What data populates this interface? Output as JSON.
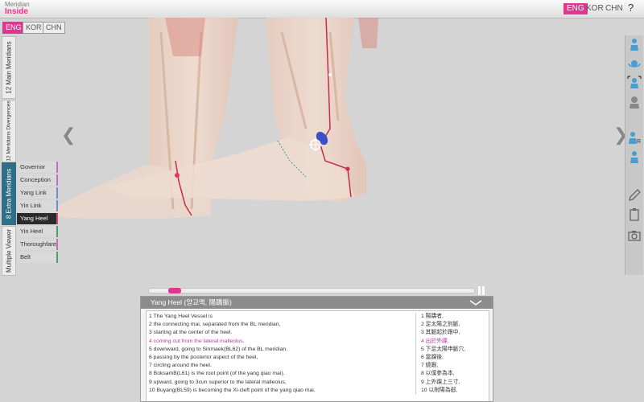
{
  "app": {
    "logo_top": "Meridian",
    "logo_bottom": "Inside",
    "languages": [
      "ENG",
      "KOR",
      "CHN"
    ],
    "active_language": "ENG",
    "help_label": "?"
  },
  "sub_languages": [
    "ENG",
    "KOR",
    "CHN"
  ],
  "left_tabs": [
    "12 Main Meridians",
    "12 Meridians Divergences",
    "8 Extra Meridians",
    "Multiple Viewer"
  ],
  "active_tab": "8 Extra Meridians",
  "extra_meridians": [
    {
      "label": "Governor",
      "color": "#c06fc0"
    },
    {
      "label": "Conception",
      "color": "#c06fc0"
    },
    {
      "label": "Yang Link",
      "color": "#6f8fd0"
    },
    {
      "label": "Yin Link",
      "color": "#6f8fd0"
    },
    {
      "label": "Yang Heel",
      "color": "#d04a7a"
    },
    {
      "label": "Yin Heel",
      "color": "#4aa06a"
    },
    {
      "label": "Thoroughfare",
      "color": "#c06fc0"
    },
    {
      "label": "Belt",
      "color": "#4aa06a"
    }
  ],
  "active_meridian": "Yang Heel",
  "nav": {
    "prev": "❮",
    "next": "❯"
  },
  "right_tools": [
    "person-front-icon",
    "head-rotate-icon",
    "body-view-icon",
    "head-profile-icon",
    "person-r-icon",
    "person-l-icon",
    "pencil-icon",
    "clipboard-icon",
    "camera-icon"
  ],
  "playback": {
    "progress": 0.06
  },
  "panel": {
    "title": "Yang Heel (양교맥, 陽蹻脈)",
    "english_lines": [
      "1 The Yang Heel Vessel is",
      "2 the connecting mai, separated from the BL meridian,",
      "3 starting at the center of the heel.",
      "4 coming out from the lateral malleolus,",
      "5 downward, going to Sinmaek(BL62) of the BL meridian.",
      "6 passing by the posterior aspect of the heel,",
      "7 circling around the heel.",
      "8 BoksamB(L61) is the root point (of the yang qiao mai).",
      "9 upward, going to 3cun superior to the lateral malleolus,",
      "10 Buyang(BL59) is becoming the Xi-cleft point of the yang qiao mai."
    ],
    "chinese_lines": [
      "1 陽蹻者,",
      "2 足太陽之別脈,",
      "3 其脈起於跟中,",
      "4 出於外踝,",
      "5 下足太陽申脈穴,",
      "6 當踝後,",
      "7 繞跟,",
      "8 以僕參為本,",
      "9 上外踝上三寸,",
      "10 以附陽為郄,"
    ],
    "highlight_index": 3
  },
  "colors": {
    "accent": "#e2358e",
    "tab_active": "#2e6e86",
    "highlight_text": "#b43ca8"
  }
}
